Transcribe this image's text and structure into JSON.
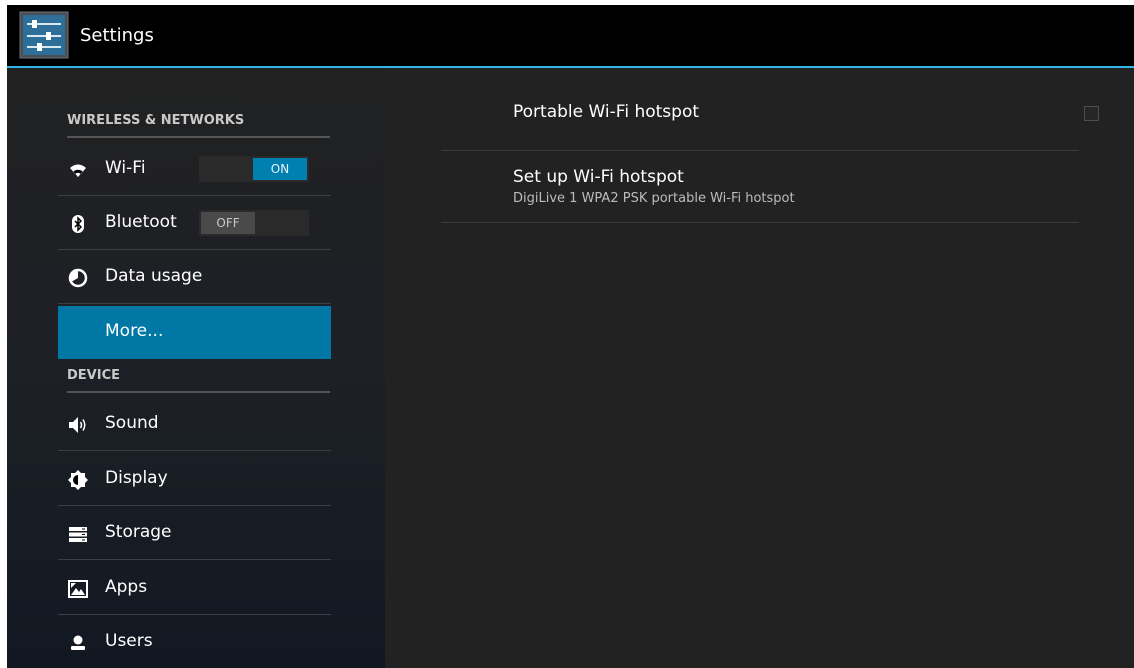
{
  "app": {
    "title": "Settings"
  },
  "sidebar": {
    "sections": [
      {
        "header": "WIRELESS & NETWORKS"
      },
      {
        "header": "DEVICE"
      }
    ],
    "items": [
      {
        "label": "Wi-Fi",
        "icon": "wifi-icon",
        "toggle": "ON"
      },
      {
        "label": "Bluetooth",
        "icon": "bluetooth-icon",
        "toggle": "OFF"
      },
      {
        "label": "Data usage",
        "icon": "data-usage-icon"
      },
      {
        "label": "More...",
        "selected": true
      },
      {
        "label": "Sound",
        "icon": "speaker-icon"
      },
      {
        "label": "Display",
        "icon": "brightness-icon"
      },
      {
        "label": "Storage",
        "icon": "storage-icon"
      },
      {
        "label": "Apps",
        "icon": "apps-icon"
      },
      {
        "label": "Users",
        "icon": "user-icon"
      }
    ]
  },
  "detail": {
    "hotspot": {
      "title": "Portable Wi-Fi hotspot",
      "checked": false
    },
    "setup": {
      "title": "Set up Wi-Fi hotspot",
      "summary": "DigiLive 1 WPA2 PSK portable Wi-Fi hotspot"
    }
  },
  "colors": {
    "accent": "#33b5e5",
    "selected": "#0077a5"
  }
}
